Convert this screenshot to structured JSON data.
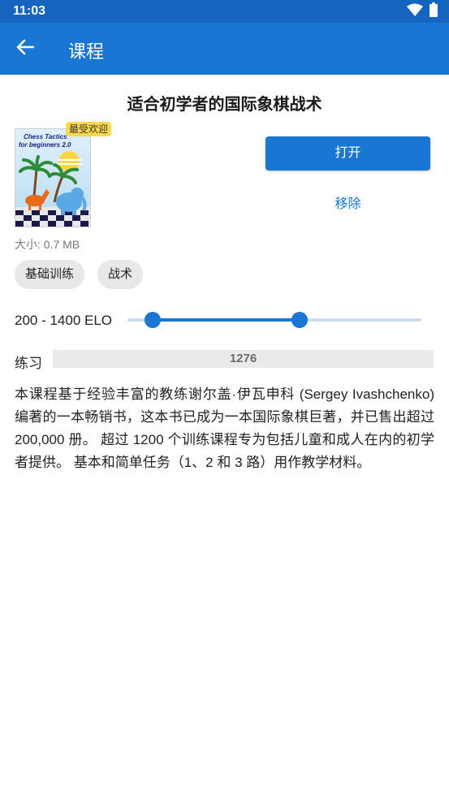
{
  "status_bar": {
    "time": "11:03",
    "icons": [
      "wifi-icon",
      "battery-icon"
    ]
  },
  "app_bar": {
    "back_icon": "arrow-left-icon",
    "title": "课程"
  },
  "course": {
    "title": "适合初学者的国际象棋战术",
    "cover_title_line1": "Chess Tactics",
    "cover_title_line2": "for beginners 2.0",
    "badge": "最受欢迎",
    "open_label": "打开",
    "remove_label": "移除",
    "size": "大小: 0.7 MB",
    "tags": [
      "基础训练",
      "战术"
    ],
    "elo_range_label": "200 - 1400 ELO",
    "elo_slider": {
      "low_fraction": 0.085,
      "high_fraction": 0.585
    },
    "practice_label": "练习",
    "practice_value": "1276",
    "description": "本课程基于经验丰富的教练谢尔盖·伊瓦申科 (Sergey Ivashchenko) 编著的一本畅销书，这本书已成为一本国际象棋巨著，并已售出超过 200,000 册。 超过 1200 个训练课程专为包括儿童和成人在内的初学者提供。 基本和简单任务（1、2 和 3 路）用作教学材料。"
  },
  "colors": {
    "primary": "#1976d2",
    "status_bar": "#1565c0",
    "badge": "#ffd84d",
    "chip_bg": "#e8e8e8",
    "track_bg": "#c9dcf3"
  }
}
